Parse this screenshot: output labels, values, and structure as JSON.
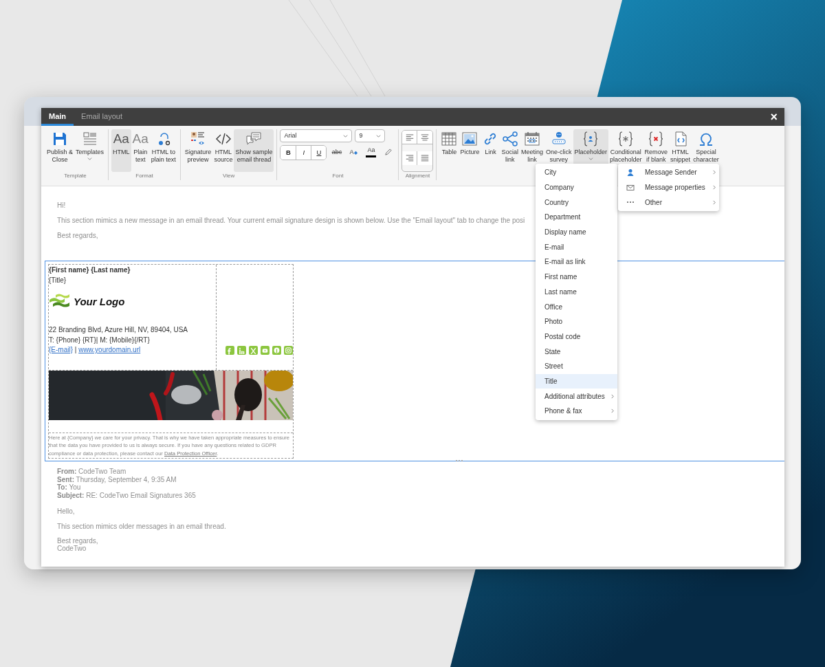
{
  "tabs": [
    {
      "label": "Main",
      "selected": true
    },
    {
      "label": "Email layout",
      "selected": false
    }
  ],
  "close_label": "×",
  "ribbon": [
    {
      "group": "Template",
      "kind": "buttons",
      "items": [
        {
          "label": "Publish &\nClose",
          "kind": "save",
          "selected": false
        },
        {
          "label": "Templates",
          "kind": "templates",
          "selected": false,
          "dropdown": true
        }
      ]
    },
    {
      "group": "Format",
      "kind": "buttons",
      "items": [
        {
          "label": "HTML",
          "glyph": "Aa",
          "kind": "dark",
          "selected": true
        },
        {
          "label": "Plain\ntext",
          "glyph": "Aa",
          "kind": "light",
          "selected": false
        },
        {
          "label": "HTML to\nplain text",
          "kind": "convert",
          "selected": false
        }
      ]
    },
    {
      "group": "View",
      "kind": "buttons",
      "items": [
        {
          "label": "Signature\npreview",
          "kind": "preview",
          "selected": false
        },
        {
          "label": "HTML\nsource",
          "kind": "code",
          "selected": false
        },
        {
          "label": "Show sample\nemail thread",
          "kind": "chat",
          "selected": true
        }
      ]
    },
    {
      "group": "Font",
      "kind": "font",
      "font": "Arial",
      "size": "9",
      "format_buttons": [
        {
          "label": "B",
          "kind": "bold"
        },
        {
          "label": "I",
          "kind": "italic"
        },
        {
          "label": "U",
          "kind": "underline"
        }
      ],
      "style_buttons": [
        {
          "label": "abc",
          "kind": "strike"
        },
        {
          "label": "A",
          "kind": "clear"
        },
        {
          "label": "Aa",
          "kind": "color"
        },
        {
          "kind": "pencil"
        }
      ]
    },
    {
      "group": "Alignment",
      "kind": "align",
      "items": [
        {
          "kind": "left"
        },
        {
          "kind": "center"
        },
        {
          "kind": "right"
        },
        {
          "kind": "justify"
        }
      ]
    },
    {
      "kind": "buttons",
      "items": [
        {
          "label": "Table",
          "kind": "table",
          "selected": false
        },
        {
          "label": "Picture",
          "kind": "picture",
          "selected": false
        },
        {
          "label": "Link",
          "kind": "link",
          "selected": false
        },
        {
          "label": "Social\nlink",
          "kind": "share",
          "selected": false
        },
        {
          "label": "Meeting\nlink",
          "kind": "calendar",
          "selected": false
        },
        {
          "label": "One-click\nsurvey",
          "kind": "survey",
          "selected": false
        },
        {
          "label": "Placeholder",
          "kind": "placeholder",
          "selected": true,
          "dropdown": true
        },
        {
          "label": "Conditional\nplaceholder",
          "kind": "conditional",
          "selected": false
        },
        {
          "label": "Remove\nif blank",
          "kind": "remove",
          "selected": false
        },
        {
          "label": "HTML\nsnippet",
          "kind": "snippet",
          "selected": false
        },
        {
          "label": "Special\ncharacter",
          "kind": "omega",
          "selected": false
        }
      ]
    }
  ],
  "new_message": [
    "Hi!",
    "This section mimics a new message in an email thread. Your current email signature design is shown below. Use the \"Email layout\" tab to change the posi",
    "Best regards,"
  ],
  "signature": {
    "name": "{First name} {Last name}",
    "title": "{Title}",
    "logo_text": "Your Logo",
    "address": "22 Branding Blvd, Azure Hill, NV, 89404, USA",
    "phone": "T: {Phone} {RT}| M: {Mobile}{/RT}",
    "email_link": "{E-mail}",
    "separator": " | ",
    "website_link": "www.yourdomain.url",
    "disclaimer": {
      "text": "Here at {Company} we care for your privacy. That is why we have taken appropriate measures to ensure that the data you have provided to us is always secure. If you have any questions related to GDPR compliance or data protection, please contact our ",
      "link": "Data Protection Officer",
      "end": "."
    }
  },
  "reply_header": [
    "**From:** CodeTwo Team",
    "**Sent:** Thursday, September 4, 9:35 AM",
    "**To:** You",
    "**Subject:** RE: CodeTwo Email Signatures 365"
  ],
  "older_message": [
    "Hello,",
    "This section mimics older messages in an email thread.",
    "Best regards,",
    "CodeTwo"
  ],
  "field_menu": [
    {
      "label": "City",
      "selected": false
    },
    {
      "label": "Company",
      "selected": false
    },
    {
      "label": "Country",
      "selected": false
    },
    {
      "label": "Department",
      "selected": false
    },
    {
      "label": "Display name",
      "selected": false
    },
    {
      "label": "E-mail",
      "selected": false
    },
    {
      "label": "E-mail as link",
      "selected": false
    },
    {
      "label": "First name",
      "selected": false
    },
    {
      "label": "Last name",
      "selected": false
    },
    {
      "label": "Office",
      "selected": false
    },
    {
      "label": "Photo",
      "selected": false
    },
    {
      "label": "Postal code",
      "selected": false
    },
    {
      "label": "State",
      "selected": false
    },
    {
      "label": "Street",
      "selected": false
    },
    {
      "label": "Title",
      "selected": true
    },
    {
      "label": "Additional attributes",
      "selected": false,
      "submenu": true
    },
    {
      "label": "Phone & fax",
      "selected": false,
      "submenu": true
    }
  ],
  "category_menu": [
    {
      "label": "Message Sender",
      "kind": "person",
      "submenu": true
    },
    {
      "label": "Message properties",
      "kind": "envelope",
      "submenu": true
    },
    {
      "label": "Other",
      "kind": "dots",
      "submenu": true
    }
  ]
}
